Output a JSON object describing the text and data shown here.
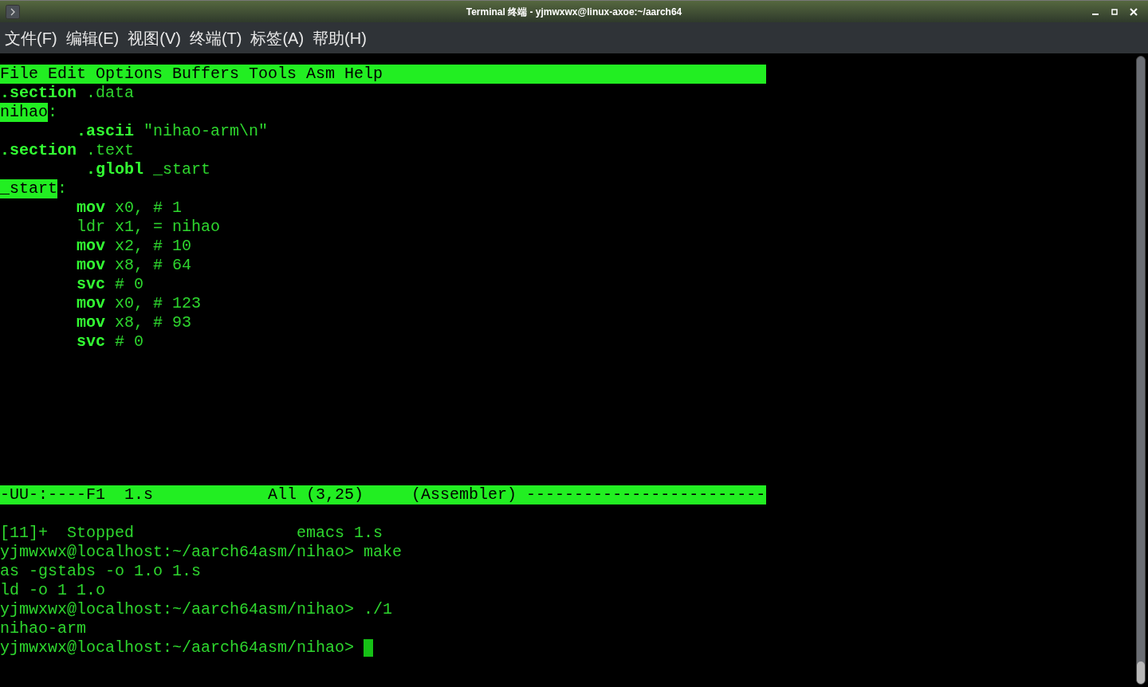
{
  "window": {
    "title": "Terminal 终端 - yjmwxwx@linux-axoe:~/aarch64"
  },
  "menu": [
    {
      "label": "文件(F)"
    },
    {
      "label": "编辑(E)"
    },
    {
      "label": "视图(V)"
    },
    {
      "label": "终端(T)"
    },
    {
      "label": "标签(A)"
    },
    {
      "label": "帮助(H)"
    }
  ],
  "editor": {
    "menu_bar": [
      {
        "label": "File"
      },
      {
        "label": "Edit"
      },
      {
        "label": "Options"
      },
      {
        "label": "Buffers"
      },
      {
        "label": "Tools"
      },
      {
        "label": "Asm"
      },
      {
        "label": "Help"
      }
    ],
    "lines": [
      {
        "text": "**.section** .data"
      },
      {
        "label": "nihao",
        "text": ":"
      },
      {
        "text": "        **.ascii** \"nihao-arm\\n\""
      },
      {
        "text": "**.section** .text"
      },
      {
        "text": "         **.globl** _start"
      },
      {
        "label": "_start",
        "text": ":"
      },
      {
        "text": "        **mov** x0, # 1"
      },
      {
        "text": "        ldr x1, = nihao"
      },
      {
        "text": "        **mov** x2, # 10"
      },
      {
        "text": "        **mov** x8, # 64"
      },
      {
        "text": "        **svc** # 0"
      },
      {
        "text": "        **mov** x0, # 123"
      },
      {
        "text": "        **mov** x8, # 93"
      },
      {
        "text": "        **svc** # 0"
      }
    ],
    "mode_line": "-UU-:----F1  1.s            All (3,25)     (Assembler) -------------------------"
  },
  "shell": {
    "lines": [
      {
        "text": "[11]+  Stopped                 emacs 1.s",
        "cursor": false
      },
      {
        "text": "yjmwxwx@localhost:~/aarch64asm/nihao> make",
        "cursor": false
      },
      {
        "text": "as -gstabs -o 1.o 1.s",
        "cursor": false
      },
      {
        "text": "ld -o 1 1.o",
        "cursor": false
      },
      {
        "text": "yjmwxwx@localhost:~/aarch64asm/nihao> ./1",
        "cursor": false
      },
      {
        "text": "nihao-arm",
        "cursor": false
      },
      {
        "text": "yjmwxwx@localhost:~/aarch64asm/nihao>",
        "cursor": true
      }
    ]
  }
}
